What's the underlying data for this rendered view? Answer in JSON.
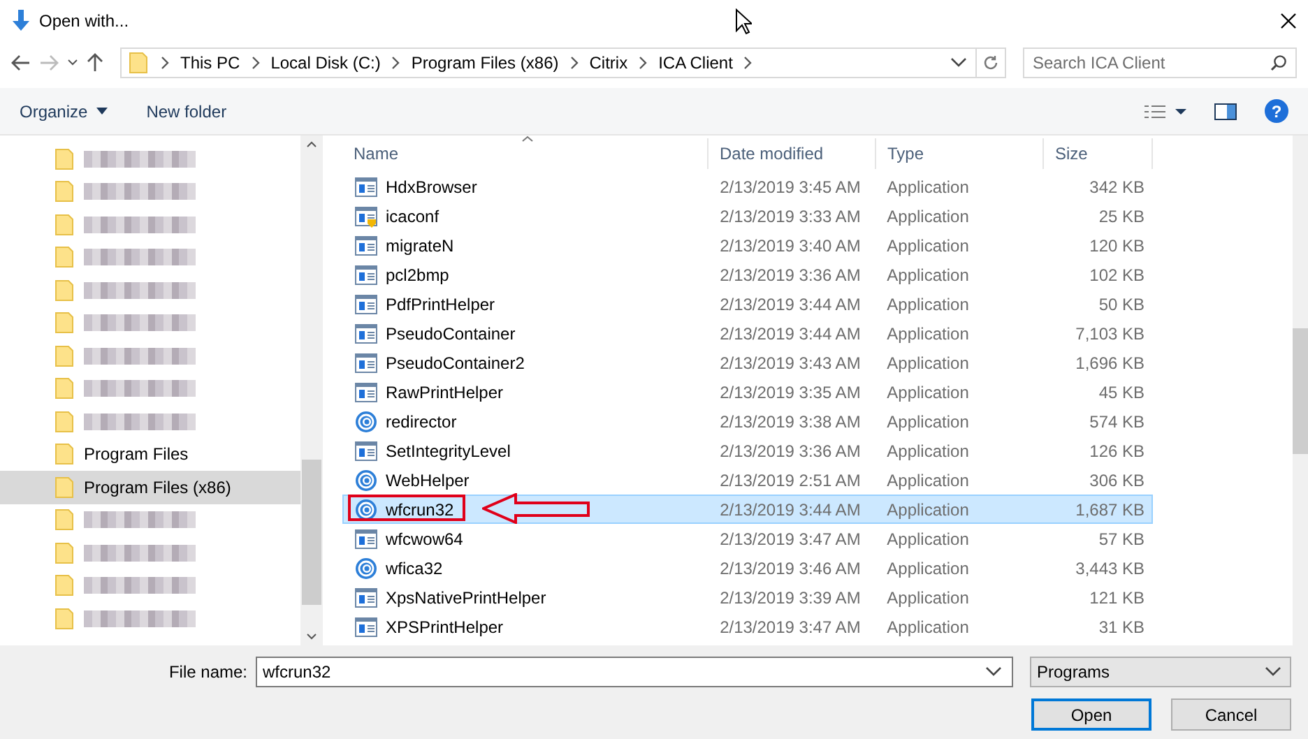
{
  "window": {
    "title": "Open with..."
  },
  "address_bar": {
    "crumbs": [
      "This PC",
      "Local Disk (C:)",
      "Program Files (x86)",
      "Citrix",
      "ICA Client"
    ]
  },
  "search": {
    "placeholder": "Search ICA Client"
  },
  "toolbar": {
    "organize": "Organize",
    "new_folder": "New folder",
    "help": "?"
  },
  "sidebar": {
    "items": [
      {
        "kind": "redacted",
        "selected": false
      },
      {
        "kind": "redacted",
        "selected": false
      },
      {
        "kind": "redacted",
        "selected": false
      },
      {
        "kind": "redacted",
        "selected": false
      },
      {
        "kind": "redacted",
        "selected": false
      },
      {
        "kind": "redacted",
        "selected": false
      },
      {
        "kind": "redacted",
        "selected": false
      },
      {
        "kind": "redacted",
        "selected": false
      },
      {
        "kind": "redacted",
        "selected": false
      },
      {
        "kind": "folder",
        "label": "Program Files",
        "selected": false
      },
      {
        "kind": "folder",
        "label": "Program Files (x86)",
        "selected": true
      },
      {
        "kind": "redacted",
        "selected": false
      },
      {
        "kind": "redacted",
        "selected": false
      },
      {
        "kind": "redacted",
        "selected": false
      },
      {
        "kind": "redacted",
        "selected": false
      }
    ]
  },
  "table": {
    "columns": [
      "Name",
      "Date modified",
      "Type",
      "Size"
    ],
    "rows": [
      {
        "kind": "window",
        "name": "HdxBrowser",
        "date": "2/13/2019 3:45 AM",
        "type": "Application",
        "size": "342 KB",
        "selected": false,
        "marked": false
      },
      {
        "kind": "badged",
        "name": "icaconf",
        "date": "2/13/2019 3:33 AM",
        "type": "Application",
        "size": "25 KB",
        "selected": false,
        "marked": false
      },
      {
        "kind": "window",
        "name": "migrateN",
        "date": "2/13/2019 3:40 AM",
        "type": "Application",
        "size": "120 KB",
        "selected": false,
        "marked": false
      },
      {
        "kind": "window",
        "name": "pcl2bmp",
        "date": "2/13/2019 3:36 AM",
        "type": "Application",
        "size": "102 KB",
        "selected": false,
        "marked": false
      },
      {
        "kind": "window",
        "name": "PdfPrintHelper",
        "date": "2/13/2019 3:44 AM",
        "type": "Application",
        "size": "50 KB",
        "selected": false,
        "marked": false
      },
      {
        "kind": "window",
        "name": "PseudoContainer",
        "date": "2/13/2019 3:44 AM",
        "type": "Application",
        "size": "7,103 KB",
        "selected": false,
        "marked": false
      },
      {
        "kind": "window",
        "name": "PseudoContainer2",
        "date": "2/13/2019 3:43 AM",
        "type": "Application",
        "size": "1,696 KB",
        "selected": false,
        "marked": false
      },
      {
        "kind": "window",
        "name": "RawPrintHelper",
        "date": "2/13/2019 3:35 AM",
        "type": "Application",
        "size": "45 KB",
        "selected": false,
        "marked": false
      },
      {
        "kind": "swirl",
        "name": "redirector",
        "date": "2/13/2019 3:38 AM",
        "type": "Application",
        "size": "574 KB",
        "selected": false,
        "marked": false
      },
      {
        "kind": "window",
        "name": "SetIntegrityLevel",
        "date": "2/13/2019 3:36 AM",
        "type": "Application",
        "size": "126 KB",
        "selected": false,
        "marked": false
      },
      {
        "kind": "swirl",
        "name": "WebHelper",
        "date": "2/13/2019 2:51 AM",
        "type": "Application",
        "size": "306 KB",
        "selected": false,
        "marked": false
      },
      {
        "kind": "swirl",
        "name": "wfcrun32",
        "date": "2/13/2019 3:44 AM",
        "type": "Application",
        "size": "1,687 KB",
        "selected": true,
        "marked": true
      },
      {
        "kind": "window",
        "name": "wfcwow64",
        "date": "2/13/2019 3:47 AM",
        "type": "Application",
        "size": "57 KB",
        "selected": false,
        "marked": false
      },
      {
        "kind": "swirl",
        "name": "wfica32",
        "date": "2/13/2019 3:46 AM",
        "type": "Application",
        "size": "3,443 KB",
        "selected": false,
        "marked": false
      },
      {
        "kind": "window",
        "name": "XpsNativePrintHelper",
        "date": "2/13/2019 3:39 AM",
        "type": "Application",
        "size": "121 KB",
        "selected": false,
        "marked": false
      },
      {
        "kind": "window",
        "name": "XPSPrintHelper",
        "date": "2/13/2019 3:47 AM",
        "type": "Application",
        "size": "31 KB",
        "selected": false,
        "marked": false
      }
    ]
  },
  "footer": {
    "file_name_label": "File name:",
    "file_name": "wfcrun32",
    "filter": "Programs",
    "open": "Open",
    "cancel": "Cancel"
  }
}
